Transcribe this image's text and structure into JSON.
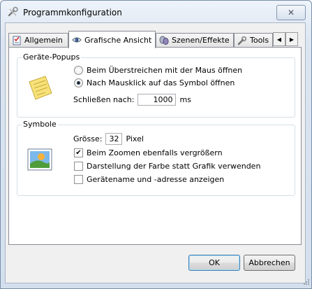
{
  "window": {
    "title": "Programmkonfiguration",
    "title_icon": "wrench-screwdriver-icon",
    "close_glyph": "✕"
  },
  "tabs": [
    {
      "label": "Allgemein",
      "icon": "checklist-icon"
    },
    {
      "label": "Grafische Ansicht",
      "icon": "eye-icon",
      "active": true
    },
    {
      "label": "Szenen/Effekte",
      "icon": "drama-masks-icon"
    },
    {
      "label": "Tools",
      "icon": "tools-icon"
    }
  ],
  "tab_scroll": {
    "left": "◀",
    "right": "▶"
  },
  "popups": {
    "title": "Geräte-Popups",
    "icon": "sticky-note-icon",
    "option_hover": "Beim Überstreichen mit der Maus öffnen",
    "option_click": "Nach Mausklick auf das Symbol öffnen",
    "selected": "click",
    "close_label": "Schließen nach:",
    "close_value": "1000",
    "close_unit": "ms"
  },
  "symbols": {
    "title": "Symbole",
    "icon": "landscape-picture-icon",
    "size_label": "Grösse:",
    "size_value": "32",
    "size_unit": "Pixel",
    "checkboxes": [
      {
        "label": "Beim Zoomen ebenfalls vergrößern",
        "checked": true
      },
      {
        "label": "Darstellung der Farbe statt Grafik verwenden",
        "checked": false
      },
      {
        "label": "Gerätename und -adresse anzeigen",
        "checked": false
      }
    ],
    "check_glyph": "✔"
  },
  "buttons": {
    "ok": "OK",
    "cancel": "Abbrechen"
  }
}
